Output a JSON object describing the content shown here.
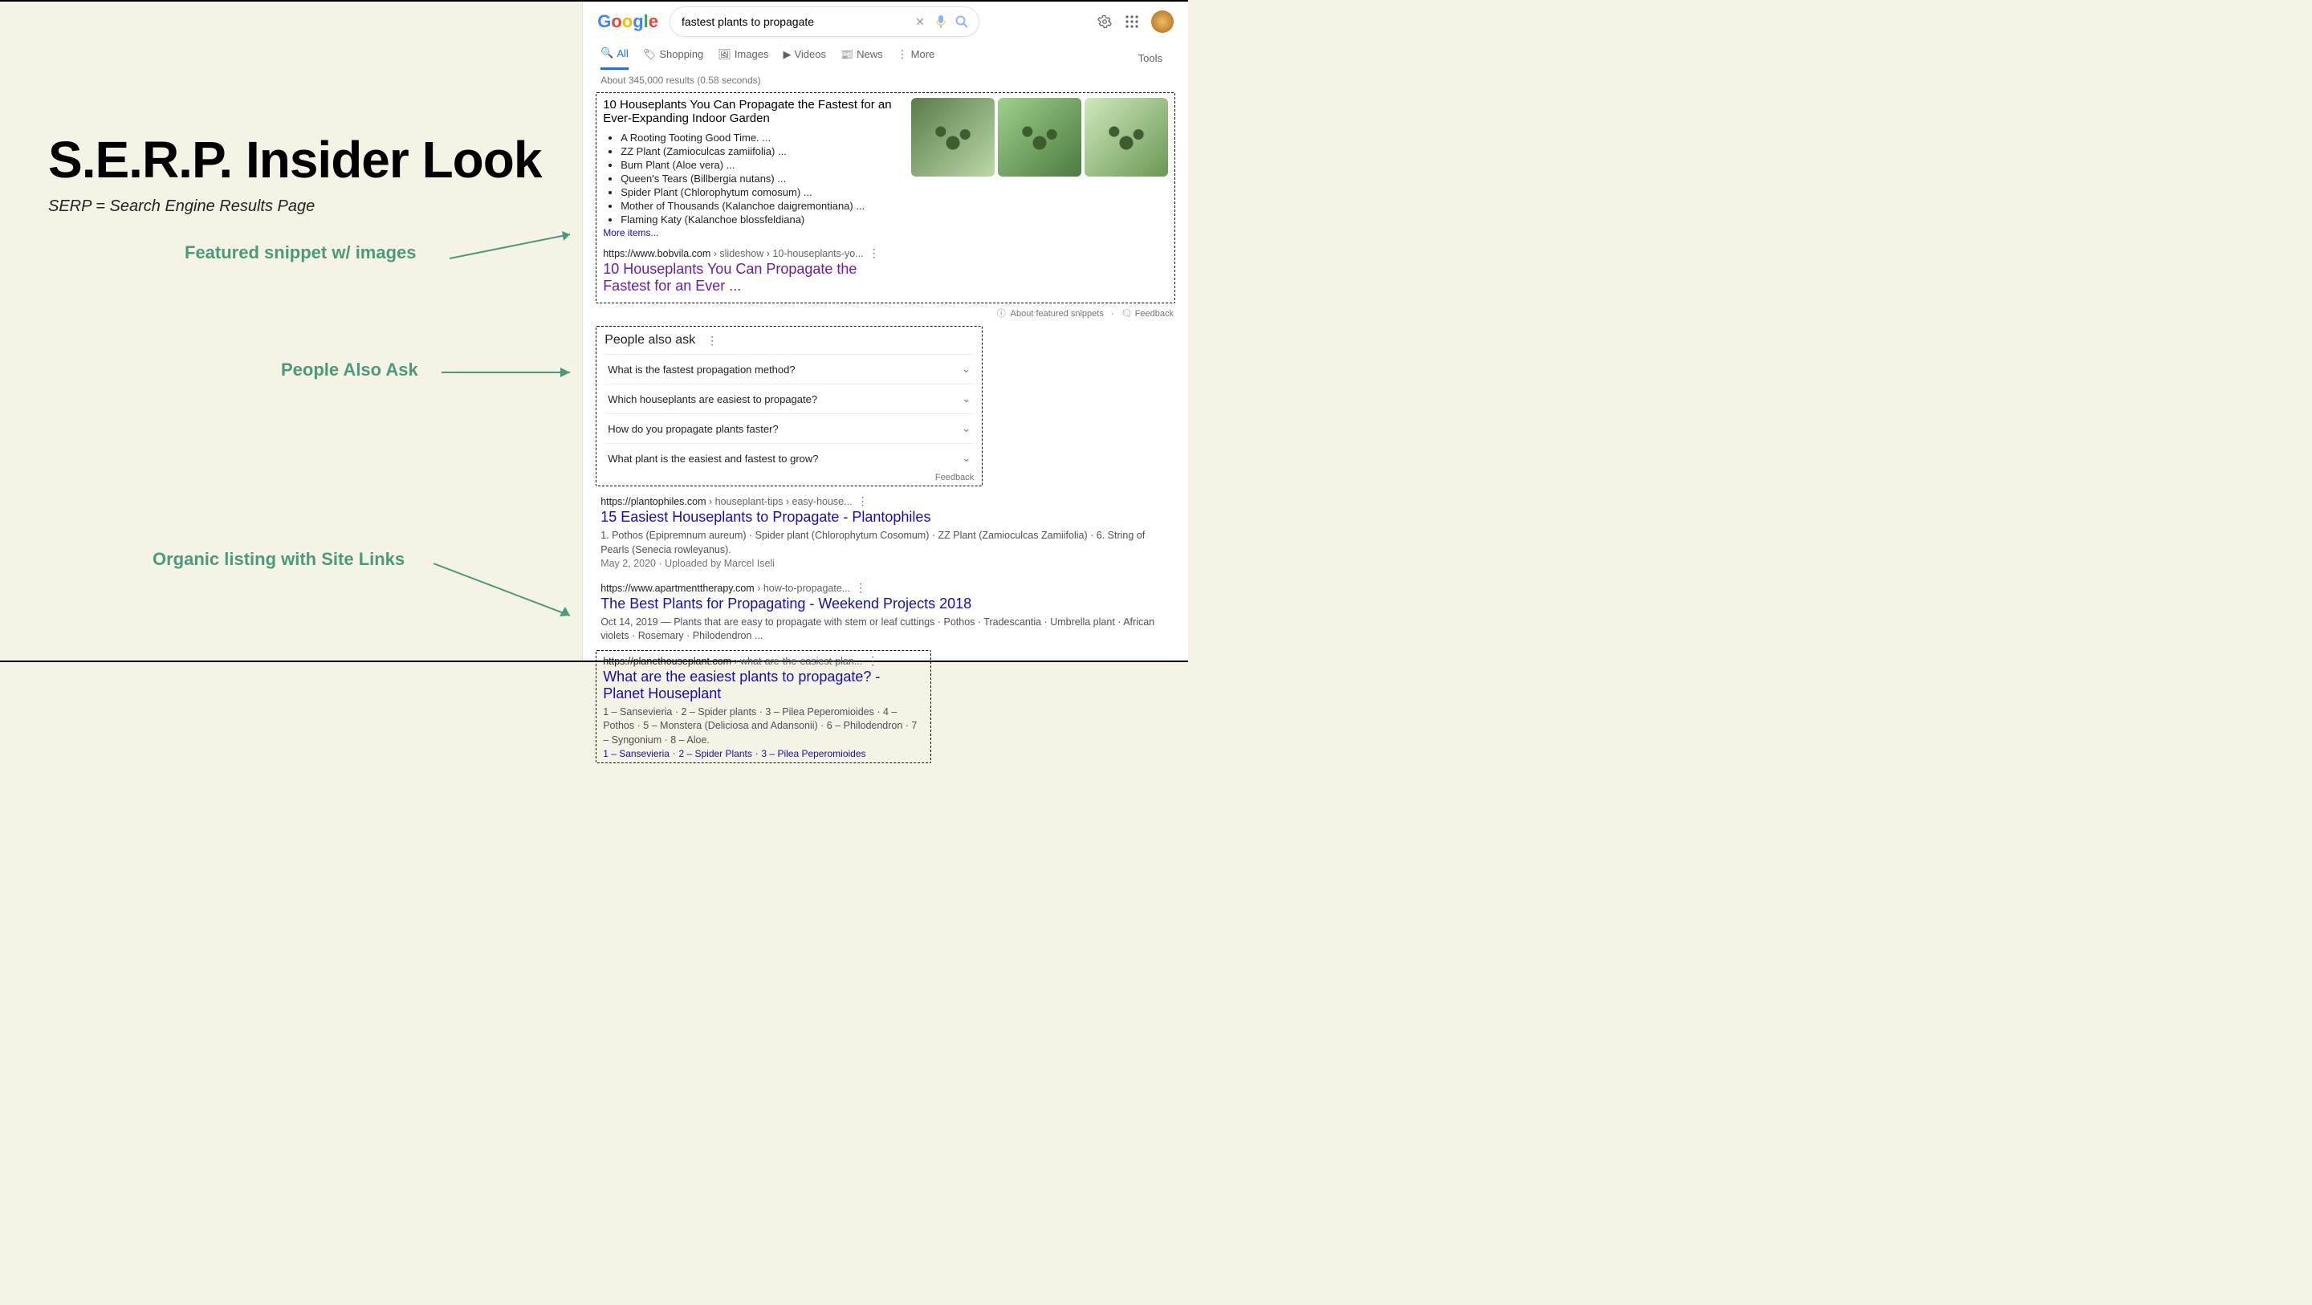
{
  "left": {
    "title": "S.E.R.P. Insider Look",
    "subtitle": "SERP = Search Engine Results Page",
    "labels": {
      "featured": "Featured snippet w/ images",
      "paa": "People Also Ask",
      "organic": "Organic listing with Site Links"
    }
  },
  "google": {
    "logo": {
      "g": "G",
      "o1": "o",
      "o2": "o",
      "g2": "g",
      "l": "l",
      "e": "e"
    },
    "search": {
      "value": "fastest plants to propagate",
      "clear": "×"
    },
    "tabs": {
      "all": "All",
      "shopping": "Shopping",
      "images": "Images",
      "videos": "Videos",
      "news": "News",
      "more": "More",
      "tools": "Tools"
    },
    "stats": "About 345,000 results (0.58 seconds)",
    "snippet": {
      "title": "10 Houseplants You Can Propagate the Fastest for an Ever-Expanding Indoor Garden",
      "items": [
        "A Rooting Tooting Good Time. ...",
        "ZZ Plant (Zamioculcas zamiifolia) ...",
        "Burn Plant (Aloe vera) ...",
        "Queen's Tears (Billbergia nutans) ...",
        "Spider Plant (Chlorophytum comosum) ...",
        "Mother of Thousands (Kalanchoe daigremontiana) ...",
        "Flaming Katy (Kalanchoe blossfeldiana)"
      ],
      "more": "More items...",
      "cite_host": "https://www.bobvila.com",
      "cite_path": " › slideshow › 10-houseplants-yo...",
      "link_title": "10 Houseplants You Can Propagate the Fastest for an Ever ..."
    },
    "about_featured": "About featured snippets",
    "feedback": "Feedback",
    "paa": {
      "title": "People also ask",
      "q1": "What is the fastest propagation method?",
      "q2": "Which houseplants are easiest to propagate?",
      "q3": "How do you propagate plants faster?",
      "q4": "What plant is the easiest and fastest to grow?",
      "fb": "Feedback"
    },
    "res1": {
      "cite_host": "https://plantophiles.com",
      "cite_path": " › houseplant-tips › easy-house...",
      "title": "15 Easiest Houseplants to Propagate - Plantophiles",
      "snip": "1. Pothos (Epipremnum aureum) · Spider plant (Chlorophytum Cosomum) · ZZ Plant (Zamioculcas Zamiifolia) · 6. String of Pearls (Senecia rowleyanus).",
      "meta": "May 2, 2020 · Uploaded by Marcel Iseli"
    },
    "res2": {
      "cite_host": "https://www.apartmenttherapy.com",
      "cite_path": " › how-to-propagate...",
      "title": "The Best Plants for Propagating - Weekend Projects 2018",
      "snip": "Oct 14, 2019 — Plants that are easy to propagate with stem or leaf cuttings · Pothos · Tradescantia · Umbrella plant · African violets · Rosemary · Philodendron ..."
    },
    "res3": {
      "cite_host": "https://planethouseplant.com",
      "cite_path": " › what-are-the-easiest-plan...",
      "title": "What are the easiest plants to propagate? - Planet Houseplant",
      "snip": "1 – Sansevieria · 2 – Spider plants · 3 – Pilea Peperomioides · 4 – Pothos · 5 – Monstera (Deliciosa and Adansonii) · 6 – Philodendron · 7 – Syngonium · 8 – Aloe.",
      "sl1": "1 – Sansevieria",
      "sl2": "2 – Spider Plants",
      "sl3": "3 – Pilea Peperomioides"
    }
  }
}
